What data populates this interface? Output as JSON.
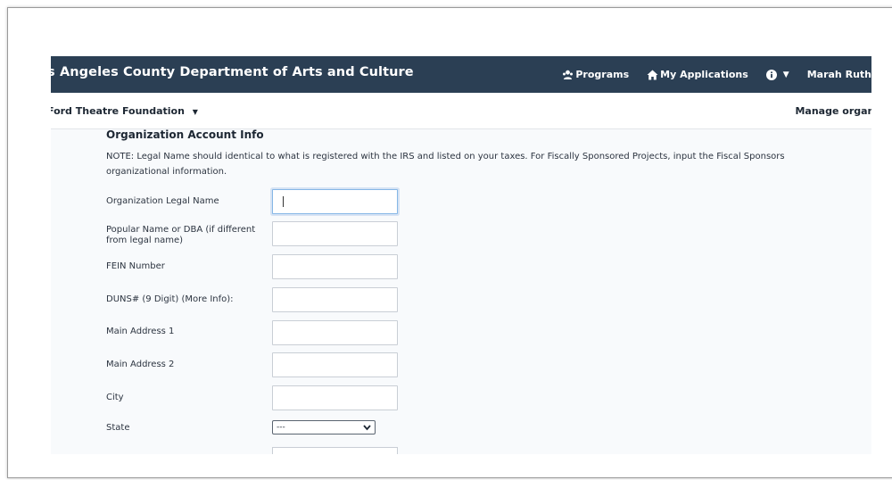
{
  "navbar": {
    "brand": "os Angeles County Department of Arts and Culture",
    "programs_label": "Programs",
    "my_applications_label": "My Applications",
    "user_name": "Marah Ruth"
  },
  "subbar": {
    "org_name": "Ford Theatre Foundation",
    "manage_link": "Manage organizati"
  },
  "form": {
    "section_title": "Organization Account Info",
    "note": "NOTE: Legal Name should identical to what is registered with the IRS and listed on your taxes. For Fiscally Sponsored Projects, input the Fiscal Sponsors organizational information.",
    "fields": {
      "legal_name": {
        "label": "Organization Legal Name",
        "value": ""
      },
      "popular_name": {
        "label": "Popular Name or DBA (if different from legal name)",
        "value": ""
      },
      "fein": {
        "label": "FEIN Number",
        "value": ""
      },
      "duns": {
        "label": "DUNS# (9 Digit) (More Info):",
        "value": ""
      },
      "address1": {
        "label": "Main Address 1",
        "value": ""
      },
      "address2": {
        "label": "Main Address 2",
        "value": ""
      },
      "city": {
        "label": "City",
        "value": ""
      },
      "state": {
        "label": "State",
        "selected": "---"
      }
    }
  },
  "colors": {
    "navbar_bg": "#2b3f54",
    "page_bg": "#f8fafc",
    "focus_border": "#86b7e6"
  }
}
